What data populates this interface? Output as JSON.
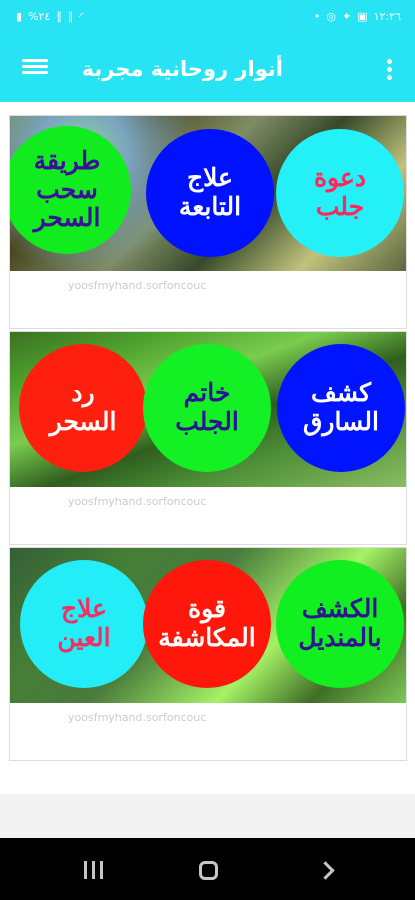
{
  "status_bar": {
    "left": "%٢٤",
    "right": "١٢:٢٦"
  },
  "app_bar": {
    "title": "أنوار روحانية مجربة"
  },
  "cards": [
    {
      "buttons": [
        {
          "text": [
            "طريقة",
            "سحب",
            "السحر"
          ],
          "bg": "#11ec1e",
          "color": "#3c0f9a"
        },
        {
          "text": [
            "علاج",
            "التابعة"
          ],
          "bg": "#0011ff",
          "color": "#ffffff"
        },
        {
          "text": [
            "دعوة",
            "جلب"
          ],
          "bg": "#24f0f8",
          "color": "#ff285c"
        }
      ]
    },
    {
      "buttons": [
        {
          "text": [
            "رد",
            "السحر"
          ],
          "bg": "#ff1f0e",
          "color": "#ffffff"
        },
        {
          "text": [
            "خاتم",
            "الجلب"
          ],
          "bg": "#13f125",
          "color": "#2e1296"
        },
        {
          "text": [
            "كشف",
            "السارق"
          ],
          "bg": "#0014ff",
          "color": "#ffffff"
        }
      ]
    },
    {
      "buttons": [
        {
          "text": [
            "علاج",
            "العين"
          ],
          "bg": "#23eef8",
          "color": "#f22f61"
        },
        {
          "text": [
            "قوة",
            "المكاشفة"
          ],
          "bg": "#ff170c",
          "color": "#ffffff"
        },
        {
          "text": [
            "الكشف",
            "بالمنديل"
          ],
          "bg": "#12ef21",
          "color": "#2f148f"
        }
      ]
    }
  ]
}
